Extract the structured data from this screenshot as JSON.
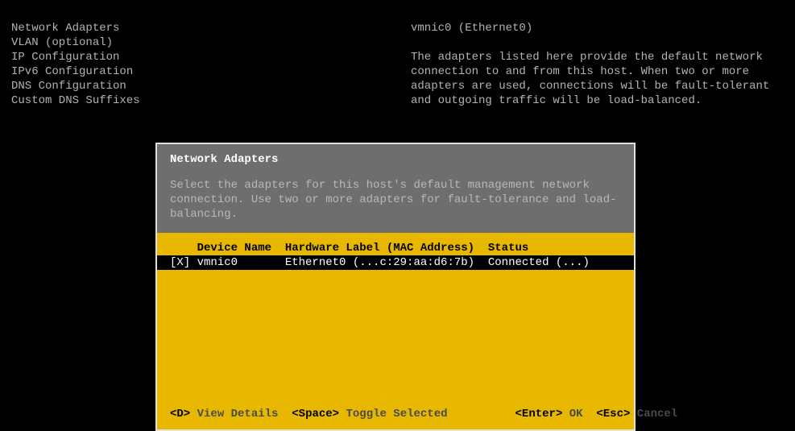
{
  "menu": {
    "items": [
      "Network Adapters",
      "VLAN (optional)",
      "",
      "IP Configuration",
      "IPv6 Configuration",
      "DNS Configuration",
      "Custom DNS Suffixes"
    ]
  },
  "info_panel": {
    "title": "vmnic0 (Ethernet0)",
    "body": "The adapters listed here provide the default network connection to and from this host. When two or more adapters are used, connections will be fault-tolerant and outgoing traffic will be load-balanced."
  },
  "dialog": {
    "title": "Network Adapters",
    "description": "Select the adapters for this host's default management network connection. Use two or more adapters for fault-tolerance and load-balancing.",
    "header_row": "    Device Name  Hardware Label (MAC Address)  Status",
    "rows": [
      {
        "checked": "[X]",
        "device": "vmnic0",
        "label": "Ethernet0 (...c:29:aa:d6:7b)",
        "status": "Connected (...)",
        "raw": "[X] vmnic0       Ethernet0 (...c:29:aa:d6:7b)  Connected (...)          "
      }
    ],
    "footer": {
      "d_key": "<D>",
      "d_act": "View Details",
      "sp_key": "<Space>",
      "sp_act": "Toggle Selected",
      "ent_key": "<Enter>",
      "ent_act": "OK",
      "esc_key": "<Esc>",
      "esc_act": "Cancel"
    }
  }
}
